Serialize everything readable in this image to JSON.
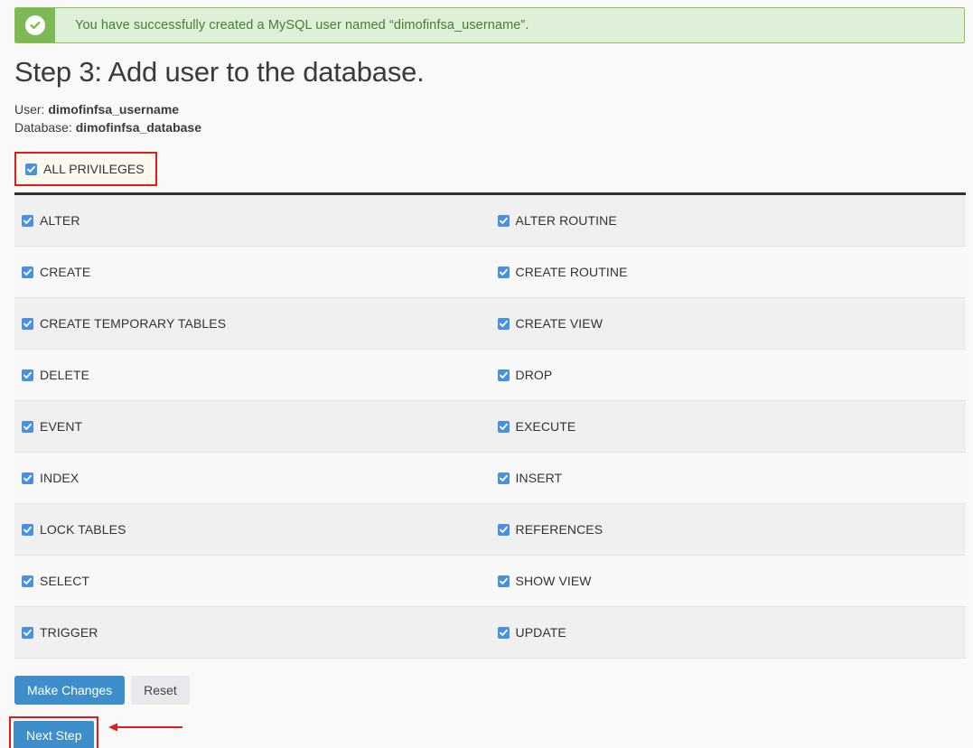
{
  "alert": {
    "icon": "check-circle-icon",
    "message": "You have successfully created a MySQL user named “dimofinfsa_username”.",
    "bg_color": "#dff0d8",
    "icon_bg_color": "#7dba55",
    "text_color": "#4a7a3a"
  },
  "heading": "Step 3: Add user to the database.",
  "meta": {
    "user_label": "User:",
    "user_value": "dimofinfsa_username",
    "database_label": "Database:",
    "database_value": "dimofinfsa_database"
  },
  "all_privileges": {
    "label": "ALL PRIVILEGES",
    "checked": true,
    "highlight_color": "#e01b1b",
    "highlight_bg": "#fbf9ed"
  },
  "privileges": {
    "rows": [
      {
        "left": {
          "label": "ALTER",
          "checked": true
        },
        "right": {
          "label": "ALTER ROUTINE",
          "checked": true
        }
      },
      {
        "left": {
          "label": "CREATE",
          "checked": true
        },
        "right": {
          "label": "CREATE ROUTINE",
          "checked": true
        }
      },
      {
        "left": {
          "label": "CREATE TEMPORARY TABLES",
          "checked": true
        },
        "right": {
          "label": "CREATE VIEW",
          "checked": true
        }
      },
      {
        "left": {
          "label": "DELETE",
          "checked": true
        },
        "right": {
          "label": "DROP",
          "checked": true
        }
      },
      {
        "left": {
          "label": "EVENT",
          "checked": true
        },
        "right": {
          "label": "EXECUTE",
          "checked": true
        }
      },
      {
        "left": {
          "label": "INDEX",
          "checked": true
        },
        "right": {
          "label": "INSERT",
          "checked": true
        }
      },
      {
        "left": {
          "label": "LOCK TABLES",
          "checked": true
        },
        "right": {
          "label": "REFERENCES",
          "checked": true
        }
      },
      {
        "left": {
          "label": "SELECT",
          "checked": true
        },
        "right": {
          "label": "SHOW VIEW",
          "checked": true
        }
      },
      {
        "left": {
          "label": "TRIGGER",
          "checked": true
        },
        "right": {
          "label": "UPDATE",
          "checked": true
        }
      }
    ],
    "checkbox_color": "#4a90e2"
  },
  "buttons": {
    "make_changes": "Make Changes",
    "reset": "Reset",
    "next_step": "Next Step",
    "primary_color": "#3e8ecc",
    "default_color": "#e9e9ed"
  },
  "annotation": {
    "arrow": "left-arrow-annotation",
    "color": "#e01b1b"
  }
}
